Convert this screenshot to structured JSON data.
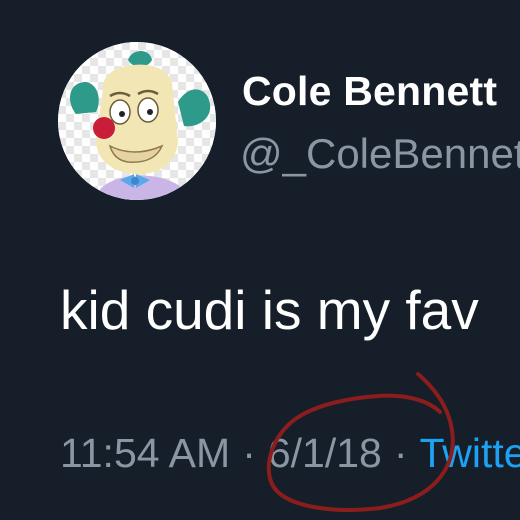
{
  "tweet": {
    "author": {
      "display_name": "Cole Bennett",
      "handle": "@_ColeBennett"
    },
    "text": "kid cudi is my fav",
    "meta": {
      "time": "11:54 AM",
      "separator": "·",
      "date": "6/1/18",
      "source": "Twitter"
    }
  },
  "colors": {
    "background": "#151e29",
    "secondary_text": "#8a96a3",
    "link": "#1da1f2",
    "annotation_circle": "#8b1d1d"
  },
  "icons": {
    "avatar": "krusty-clown-avatar-icon"
  }
}
